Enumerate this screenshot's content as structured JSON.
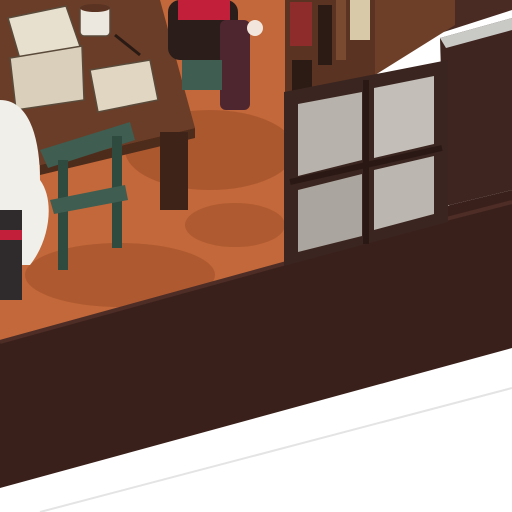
{
  "scene": {
    "type": "isometric-room-cutaway",
    "room": "cafe-study-room",
    "colors": {
      "outer_wall": "#3a201b",
      "wall_top_trim": "#4a2b24",
      "floor": "#c2683a",
      "floor_shadow": "#9a4a26",
      "table_top": "#6a3d28",
      "table_legs": "#3e2418",
      "chair": "#3f5d50",
      "window_frame": "#3a2520",
      "window_glass": "#b7b2ab",
      "background": "#ffffff"
    }
  }
}
